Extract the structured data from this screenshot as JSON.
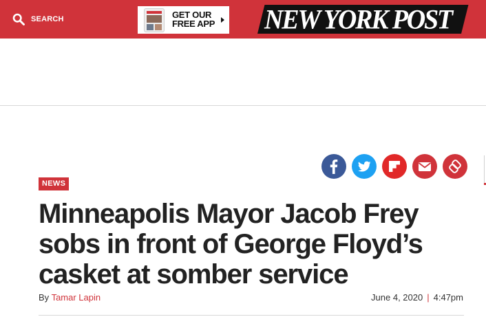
{
  "header": {
    "search_label": "SEARCH",
    "app_promo_text": "GET OUR FREE APP",
    "logo_text": "NEW YORK POST",
    "bg_color": "#d0333a"
  },
  "share": [
    {
      "name": "facebook",
      "icon": "facebook-icon",
      "color": "#3b5998"
    },
    {
      "name": "twitter",
      "icon": "twitter-icon",
      "color": "#1da1f2"
    },
    {
      "name": "flipboard",
      "icon": "flipboard-icon",
      "color": "#e12828"
    },
    {
      "name": "email",
      "icon": "email-icon",
      "color": "#d0333a"
    },
    {
      "name": "copy-link",
      "icon": "link-icon",
      "color": "#d0333a"
    }
  ],
  "article": {
    "category": "NEWS",
    "headline": "Minneapolis Mayor Jacob Frey sobs in front of George Floyd’s casket at somber service",
    "byline_prefix": "By",
    "author": "Tamar Lapin",
    "date": "June 4, 2020",
    "separator": "|",
    "time": "4:47pm"
  }
}
